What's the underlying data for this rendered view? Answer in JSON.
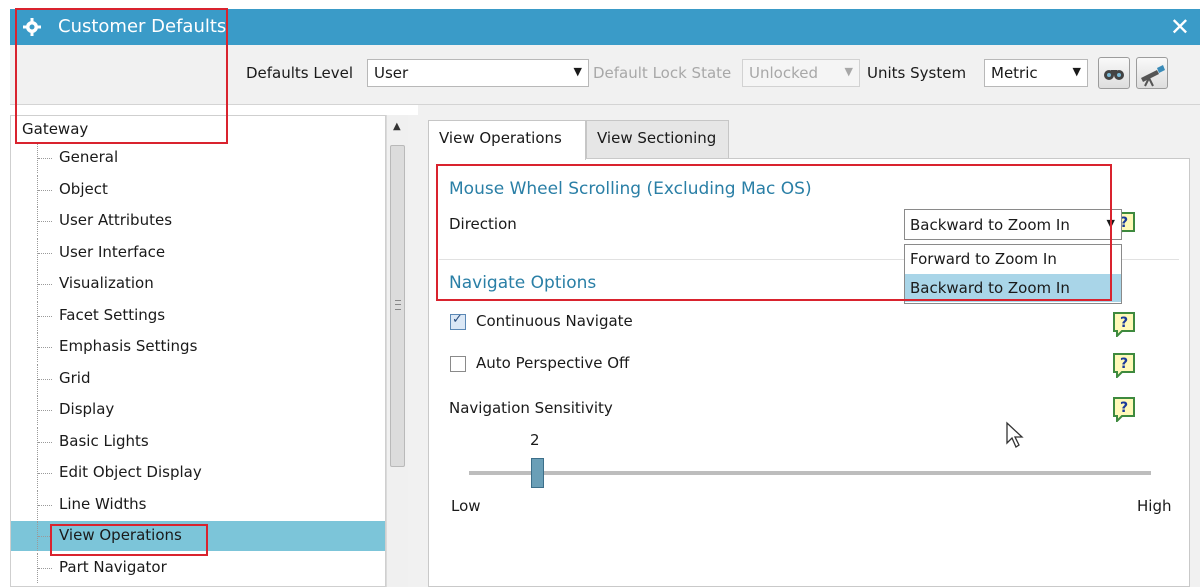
{
  "window": {
    "title": "Customer Defaults",
    "close_glyph": "✕",
    "accent_color": "#3a9bc8"
  },
  "toolbar": {
    "defaults_level_label": "Defaults Level",
    "defaults_level_value": "User",
    "lock_state_label": "Default Lock State",
    "lock_state_value": "Unlocked",
    "units_label": "Units System",
    "units_value": "Metric",
    "buttons": [
      {
        "icon": "binoculars-find-icon"
      },
      {
        "icon": "telescope-icon"
      }
    ]
  },
  "tree": {
    "root": "Gateway",
    "items": [
      {
        "label": "General"
      },
      {
        "label": "Object"
      },
      {
        "label": "User Attributes"
      },
      {
        "label": "User Interface"
      },
      {
        "label": "Visualization"
      },
      {
        "label": "Facet Settings"
      },
      {
        "label": "Emphasis Settings"
      },
      {
        "label": "Grid"
      },
      {
        "label": "Display"
      },
      {
        "label": "Basic Lights"
      },
      {
        "label": "Edit Object Display"
      },
      {
        "label": "Line Widths"
      },
      {
        "label": "View Operations",
        "selected": true
      },
      {
        "label": "Part Navigator"
      }
    ],
    "selected_color": "#7cc5d9"
  },
  "tabs": [
    {
      "label": "View Operations",
      "active": true
    },
    {
      "label": "View Sectioning",
      "active": false
    }
  ],
  "mouse_wheel": {
    "header": "Mouse Wheel Scrolling (Excluding Mac OS)",
    "direction_label": "Direction",
    "direction_value": "Backward to Zoom In",
    "options": [
      "Forward to Zoom In",
      "Backward to Zoom In"
    ],
    "selected_option": "Backward to Zoom In"
  },
  "navigate": {
    "header": "Navigate Options",
    "continuous_navigate_label": "Continuous Navigate",
    "continuous_navigate_checked": true,
    "auto_perspective_label": "Auto Perspective Off",
    "auto_perspective_checked": false,
    "sensitivity_label": "Navigation Sensitivity",
    "sensitivity_value": "2",
    "sensitivity_min_label": "Low",
    "sensitivity_max_label": "High",
    "sensitivity_fraction": 0.1
  },
  "help_glyph": "?",
  "highlight_color": "#d9232e",
  "header_color": "#2a7fa6"
}
